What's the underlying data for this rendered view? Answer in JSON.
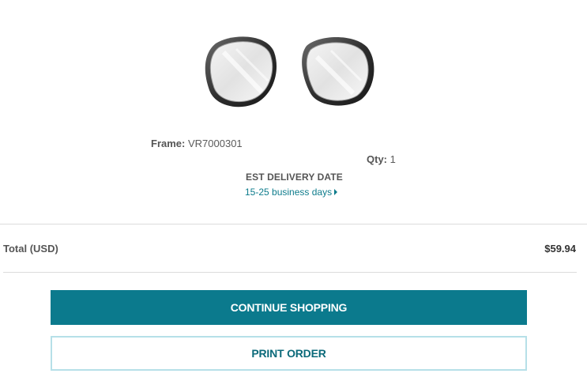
{
  "product": {
    "image_icon": "vr-lens-inserts-image",
    "frame_label": "Frame:",
    "frame_value": "VR7000301",
    "qty_label": "Qty:",
    "qty_value": "1",
    "est_delivery_label": "EST DELIVERY DATE",
    "est_delivery_value": "15-25 business days"
  },
  "totals": {
    "label": "Total (USD)",
    "value": "$59.94"
  },
  "actions": {
    "continue_label": "CONTINUE SHOPPING",
    "print_label": "PRINT ORDER"
  },
  "colors": {
    "accent": "#0b7a8d",
    "link": "#0e7c8c",
    "print_border": "#b6e0e8"
  }
}
